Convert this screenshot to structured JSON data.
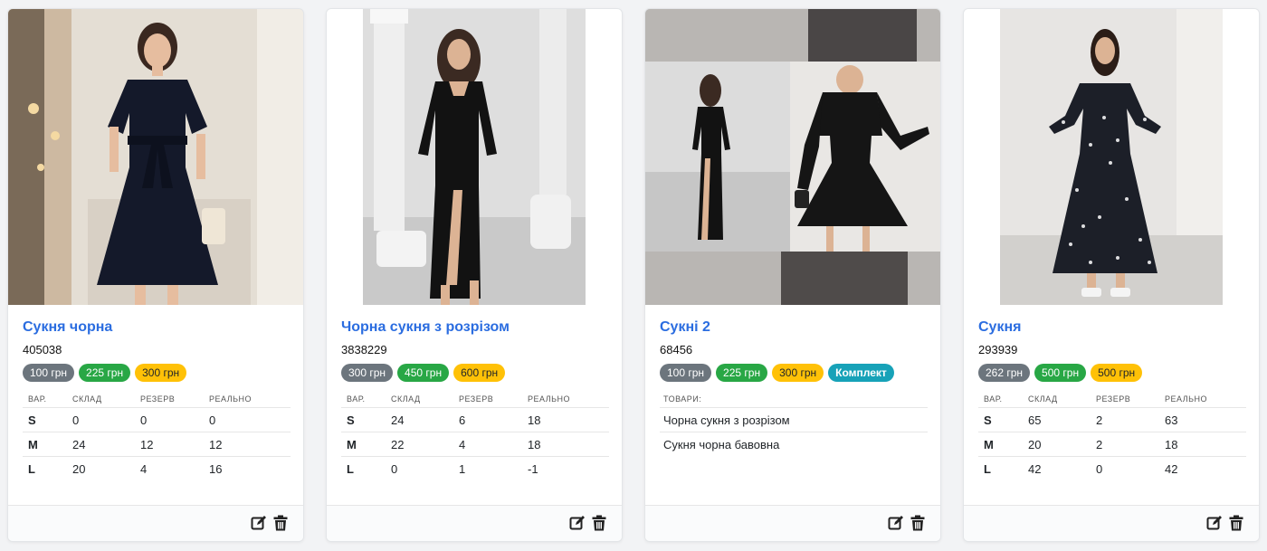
{
  "colors": {
    "gray": "#6c757d",
    "green": "#28a745",
    "yellow": "#ffc107",
    "cyan": "#17a2b8",
    "link": "#2b6de0"
  },
  "stock_headers": {
    "var": "ВАР.",
    "stock": "СКЛАД",
    "reserve": "РЕЗЕРВ",
    "real": "РЕАЛЬНО"
  },
  "items_header": "ТОВАРИ:",
  "icons": {
    "edit": "edit-icon",
    "delete": "trash-icon"
  },
  "products": [
    {
      "title": "Сукня чорна",
      "sku": "405038",
      "badges": [
        {
          "label": "100 грн",
          "color": "gray"
        },
        {
          "label": "225 грн",
          "color": "green"
        },
        {
          "label": "300 грн",
          "color": "yellow"
        }
      ],
      "variants": [
        {
          "var": "S",
          "stock": "0",
          "reserve": "0",
          "real": "0"
        },
        {
          "var": "M",
          "stock": "24",
          "reserve": "12",
          "real": "12"
        },
        {
          "var": "L",
          "stock": "20",
          "reserve": "4",
          "real": "16"
        }
      ]
    },
    {
      "title": "Чорна сукня з розрізом",
      "sku": "3838229",
      "badges": [
        {
          "label": "300 грн",
          "color": "gray"
        },
        {
          "label": "450 грн",
          "color": "green"
        },
        {
          "label": "600 грн",
          "color": "yellow"
        }
      ],
      "variants": [
        {
          "var": "S",
          "stock": "24",
          "reserve": "6",
          "real": "18"
        },
        {
          "var": "M",
          "stock": "22",
          "reserve": "4",
          "real": "18"
        },
        {
          "var": "L",
          "stock": "0",
          "reserve": "1",
          "real": "-1"
        }
      ]
    },
    {
      "title": "Сукні 2",
      "sku": "68456",
      "badges": [
        {
          "label": "100 грн",
          "color": "gray"
        },
        {
          "label": "225 грн",
          "color": "green"
        },
        {
          "label": "300 грн",
          "color": "yellow"
        },
        {
          "label": "Комплект",
          "color": "cyan"
        }
      ],
      "items": [
        "Чорна сукня з розрізом",
        "Сукня чорна бавовна"
      ]
    },
    {
      "title": "Сукня",
      "sku": "293939",
      "badges": [
        {
          "label": "262 грн",
          "color": "gray"
        },
        {
          "label": "500 грн",
          "color": "green"
        },
        {
          "label": "500 грн",
          "color": "yellow"
        }
      ],
      "variants": [
        {
          "var": "S",
          "stock": "65",
          "reserve": "2",
          "real": "63"
        },
        {
          "var": "M",
          "stock": "20",
          "reserve": "2",
          "real": "18"
        },
        {
          "var": "L",
          "stock": "42",
          "reserve": "0",
          "real": "42"
        }
      ]
    }
  ]
}
